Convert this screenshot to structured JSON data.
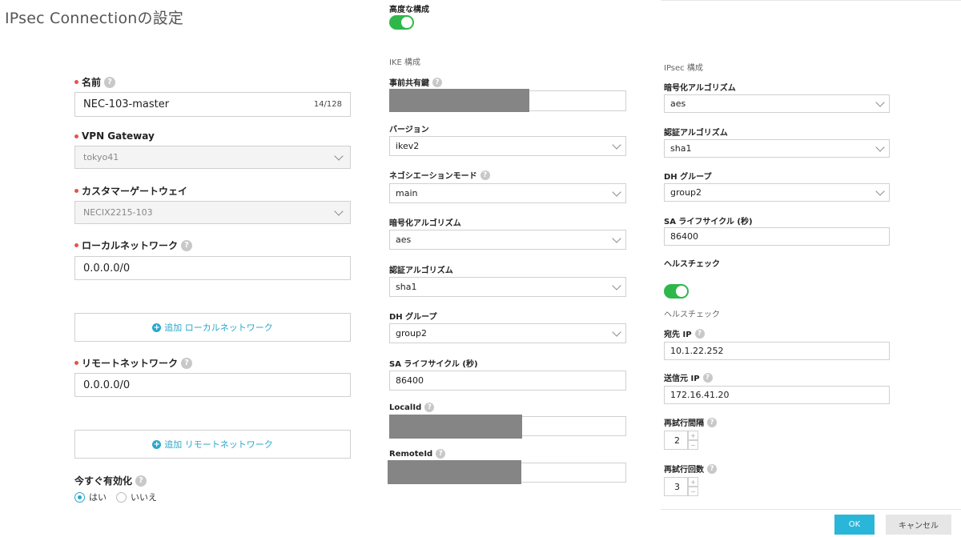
{
  "title": "IPsec Connectionの設定",
  "left": {
    "name_label": "名前",
    "name_value": "NEC-103-master",
    "name_counter": "14/128",
    "vpn_gateway_label": "VPN Gateway",
    "vpn_gateway_value": "tokyo41",
    "customer_gateway_label": "カスタマーゲートウェイ",
    "customer_gateway_value": "NECIX2215-103",
    "local_network_label": "ローカルネットワーク",
    "local_network_value": "0.0.0.0/0",
    "add_local_label": "追加 ローカルネットワーク",
    "remote_network_label": "リモートネットワーク",
    "remote_network_value": "0.0.0.0/0",
    "add_remote_label": "追加 リモートネットワーク",
    "enable_now_label": "今すぐ有効化",
    "radio_yes": "はい",
    "radio_no": "いいえ",
    "enable_now_selected": "はい"
  },
  "middle": {
    "advanced_label": "高度な構成",
    "advanced_enabled": true,
    "ike_section": "IKE 構成",
    "psk_label": "事前共有鍵",
    "version_label": "バージョン",
    "version_value": "ikev2",
    "negotiation_label": "ネゴシエーションモード",
    "negotiation_value": "main",
    "enc_label": "暗号化アルゴリズム",
    "enc_value": "aes",
    "auth_label": "認証アルゴリズム",
    "auth_value": "sha1",
    "dh_label": "DH グループ",
    "dh_value": "group2",
    "sa_label": "SA ライフサイクル (秒)",
    "sa_value": "86400",
    "localid_label": "LocalId",
    "remoteid_label": "RemoteId"
  },
  "right": {
    "ipsec_section": "IPsec 構成",
    "enc_label": "暗号化アルゴリズム",
    "enc_value": "aes",
    "auth_label": "認証アルゴリズム",
    "auth_value": "sha1",
    "dh_label": "DH グループ",
    "dh_value": "group2",
    "sa_label": "SA ライフサイクル (秒)",
    "sa_value": "86400",
    "healthcheck_label": "ヘルスチェック",
    "healthcheck_enabled": true,
    "healthcheck_section": "ヘルスチェック",
    "dest_ip_label": "宛先 IP",
    "dest_ip_value": "10.1.22.252",
    "src_ip_label": "送信元 IP",
    "src_ip_value": "172.16.41.20",
    "retry_interval_label": "再試行間隔",
    "retry_interval_value": "2",
    "retry_count_label": "再試行回数",
    "retry_count_value": "3"
  },
  "footer": {
    "ok_label": "OK",
    "cancel_label": "キャンセル"
  },
  "colors": {
    "accent": "#29b6d8",
    "toggle_on": "#2eb84a",
    "required_dot": "#e5534b",
    "mask": "#858585"
  }
}
